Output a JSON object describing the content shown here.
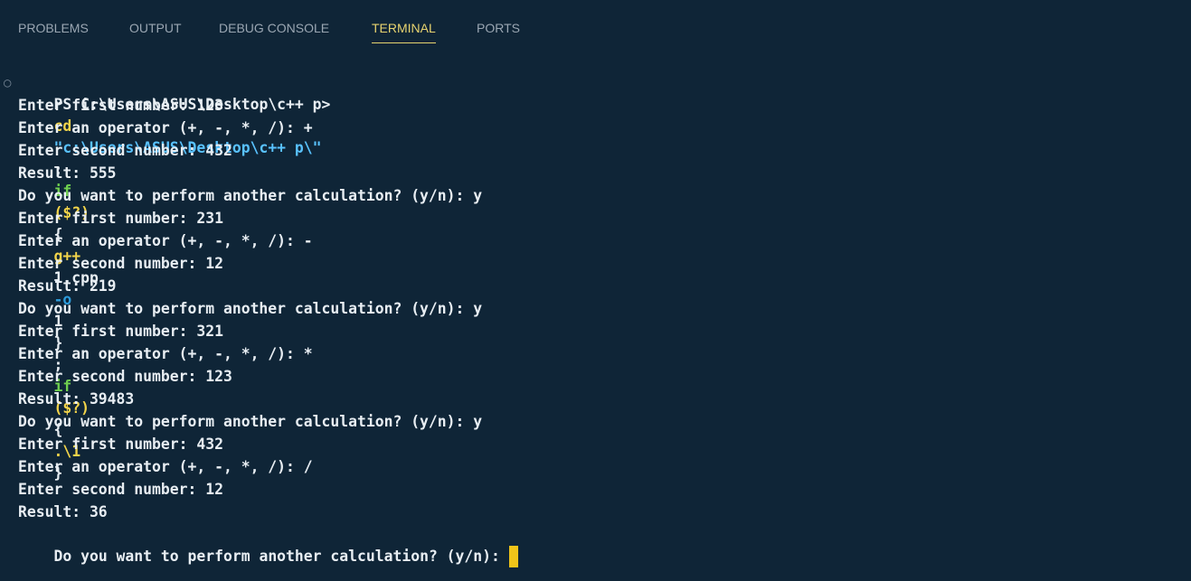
{
  "panel_tabs": [
    {
      "label": "PROBLEMS"
    },
    {
      "label": "OUTPUT"
    },
    {
      "label": "DEBUG CONSOLE"
    },
    {
      "label": "TERMINAL",
      "active": true
    },
    {
      "label": "PORTS"
    }
  ],
  "terminal": {
    "prompt": {
      "ps": "PS C:\\Users\\ASUS\\Desktop\\c++ p>",
      "cmd": "cd",
      "path": "\"c:\\Users\\ASUS\\Desktop\\c++ p\\\"",
      "semi1": ";",
      "if1": "if",
      "cond1": "($?)",
      "brace1_open": "{",
      "compiler": "g++",
      "source_file": "1.cpp",
      "flag": "-o",
      "output_name": "1",
      "brace1_close": "}",
      "semi2": ";",
      "if2": "if",
      "cond2": "($?)",
      "brace2_open": "{",
      "run_cmd": ".\\1",
      "brace2_close": "}"
    },
    "lines": [
      "Enter first number: 123",
      "Enter an operator (+, -, *, /): +",
      "Enter second number: 432",
      "Result: 555",
      "Do you want to perform another calculation? (y/n): y",
      "Enter first number: 231",
      "Enter an operator (+, -, *, /): -",
      "Enter second number: 12",
      "Result: 219",
      "Do you want to perform another calculation? (y/n): y",
      "Enter first number: 321",
      "Enter an operator (+, -, *, /): *",
      "Enter second number: 123",
      "Result: 39483",
      "Do you want to perform another calculation? (y/n): y",
      "Enter first number: 432",
      "Enter an operator (+, -, *, /): /",
      "Enter second number: 12",
      "Result: 36",
      "Do you want to perform another calculation? (y/n):"
    ]
  },
  "colors": {
    "background": "#0f2537",
    "tab_active": "#e7d36f",
    "tab_inactive": "#9aa6b2",
    "text": "#e8eef3",
    "command_yellow": "#f2d44a",
    "string_blue": "#59c2ff",
    "keyword_green": "#6fcf4f",
    "flag_blue": "#2d9cdb",
    "cursor": "#f0c419"
  }
}
